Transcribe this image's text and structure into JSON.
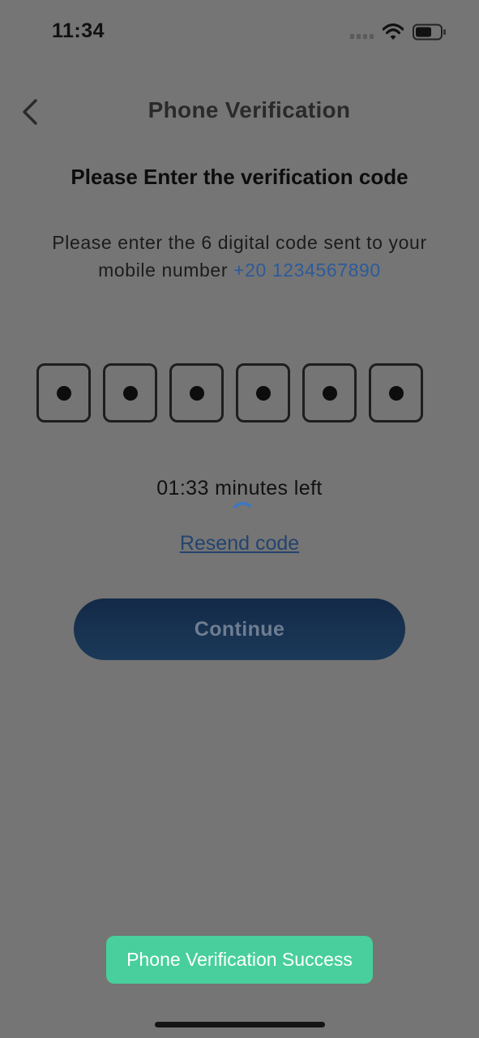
{
  "status_bar": {
    "time": "11:34",
    "icons": [
      "signal-icon",
      "wifi-icon",
      "battery-icon"
    ]
  },
  "header": {
    "back_icon": "chevron-left-icon",
    "title": "Phone Verification"
  },
  "main": {
    "heading": "Please Enter the verification code",
    "instruction_text": "Please enter the 6 digital code sent to your mobile number",
    "phone_number": "+20 1234567890",
    "otp": {
      "digit_count": 6,
      "filled": [
        true,
        true,
        true,
        true,
        true,
        true
      ],
      "mask_char": "•"
    },
    "timer_text": "01:33 minutes left",
    "resend_label": "Resend code",
    "continue_label": "Continue"
  },
  "toast": {
    "message": "Phone Verification Success"
  },
  "colors": {
    "overlay_background": "#757575",
    "link_blue": "#2d5a9a",
    "button_navy": "#132a48",
    "toast_green": "#48cf9d"
  }
}
